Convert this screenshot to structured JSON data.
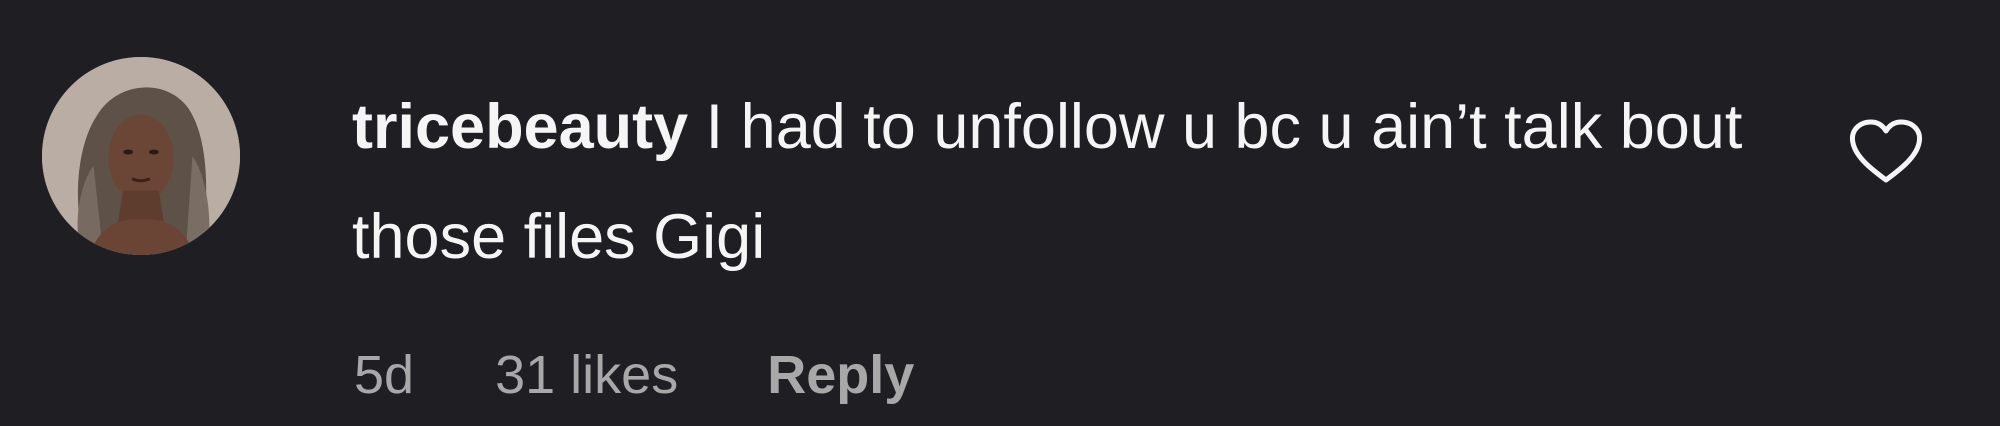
{
  "comment": {
    "username": "tricebeauty",
    "text": "I had to unfollow u bc u ain’t talk bout those files Gigi",
    "time": "5d",
    "likes": "31 likes",
    "reply_label": "Reply",
    "avatar": "profile-photo",
    "like_icon": "heart-outline-icon"
  },
  "colors": {
    "background": "#1f1f23",
    "text": "#f5f5f5",
    "meta_text": "#a8a8a8"
  }
}
